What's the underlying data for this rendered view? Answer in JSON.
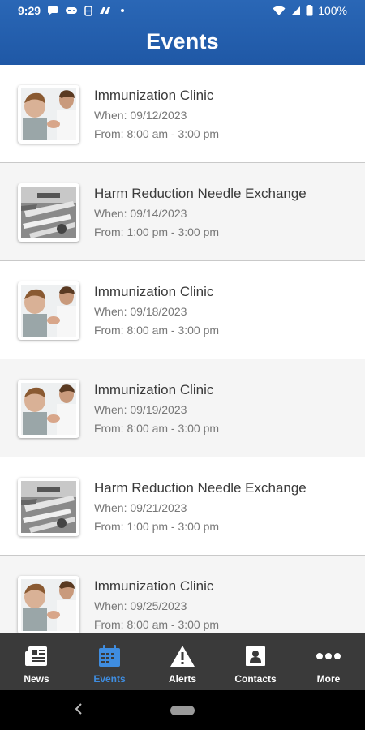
{
  "status_bar": {
    "time": "9:29",
    "battery": "100%"
  },
  "header": {
    "title": "Events"
  },
  "events": [
    {
      "title": "Immunization Clinic",
      "when": "When: 09/12/2023",
      "from": "From: 8:00 am - 3:00 pm",
      "image": "vaccination-photo"
    },
    {
      "title": "Harm Reduction Needle Exchange",
      "when": "When: 09/14/2023",
      "from": "From: 1:00 pm - 3:00 pm",
      "image": "needles-photo"
    },
    {
      "title": "Immunization Clinic",
      "when": "When: 09/18/2023",
      "from": "From: 8:00 am - 3:00 pm",
      "image": "vaccination-photo"
    },
    {
      "title": "Immunization Clinic",
      "when": "When: 09/19/2023",
      "from": "From: 8:00 am - 3:00 pm",
      "image": "vaccination-photo"
    },
    {
      "title": "Harm Reduction Needle Exchange",
      "when": "When: 09/21/2023",
      "from": "From: 1:00 pm - 3:00 pm",
      "image": "needles-photo"
    },
    {
      "title": "Immunization Clinic",
      "when": "When: 09/25/2023",
      "from": "From: 8:00 am - 3:00 pm",
      "image": "vaccination-photo"
    }
  ],
  "bottom_nav": [
    {
      "label": "News",
      "icon": "newspaper-icon",
      "active": false
    },
    {
      "label": "Events",
      "icon": "calendar-icon",
      "active": true
    },
    {
      "label": "Alerts",
      "icon": "warning-icon",
      "active": false
    },
    {
      "label": "Contacts",
      "icon": "contact-card-icon",
      "active": false
    },
    {
      "label": "More",
      "icon": "more-dots-icon",
      "active": false
    }
  ],
  "colors": {
    "header": "#2a67b6",
    "nav_bg": "#3a3a3a",
    "active": "#3f8de0"
  }
}
